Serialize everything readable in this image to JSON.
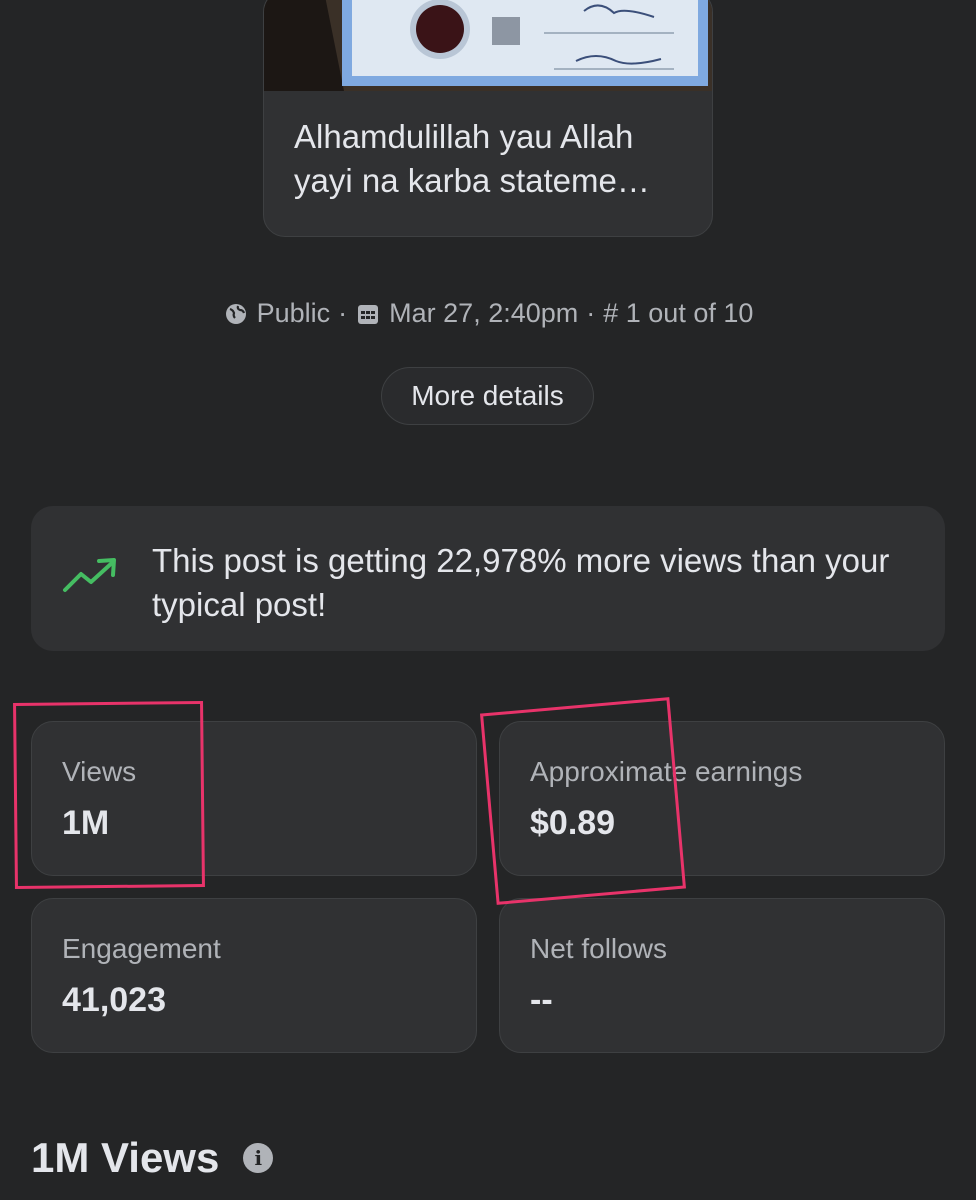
{
  "post": {
    "caption": "Alhamdulillah yau Allah yayi na karba stateme…",
    "thumbnail_icon": "certificate-photo"
  },
  "meta": {
    "audience_icon": "globe-icon",
    "audience": "Public",
    "sep1": "·",
    "date_icon": "calendar-icon",
    "date": "Mar 27, 2:40pm",
    "sep2": "·",
    "rank_icon": "hash-icon",
    "rank": "# 1 out of 10"
  },
  "more_details_label": "More details",
  "banner": {
    "icon": "trending-up-icon",
    "accent_color": "#45bd62",
    "text": "This post is getting 22,978% more views than your typical post!"
  },
  "stats": {
    "views": {
      "label": "Views",
      "value": "1M"
    },
    "earnings": {
      "label": "Approximate earnings",
      "value": "$0.89"
    },
    "engagement": {
      "label": "Engagement",
      "value": "41,023"
    },
    "follows": {
      "label": "Net follows",
      "value": "--"
    }
  },
  "highlight_color": "#e8336a",
  "section": {
    "title": "1M Views",
    "info_icon": "info-icon"
  }
}
